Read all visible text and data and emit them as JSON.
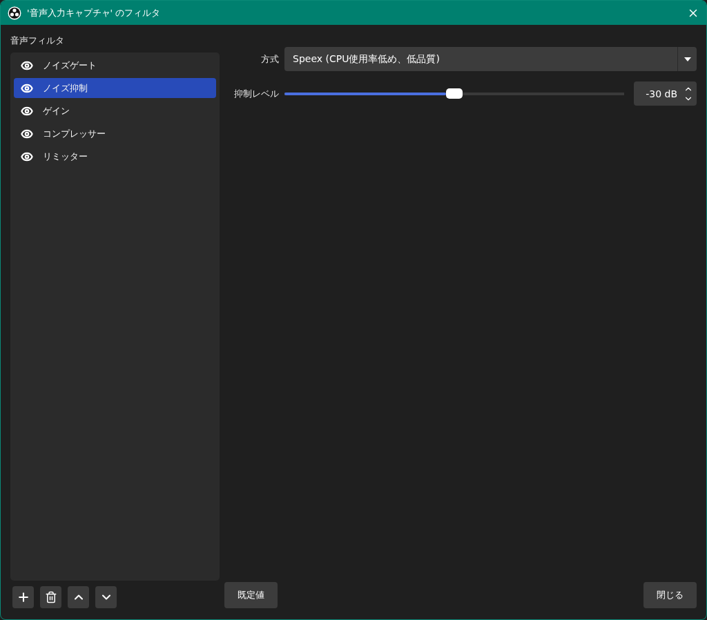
{
  "window": {
    "title": "'音声入力キャプチャ' のフィルタ"
  },
  "sidebar": {
    "heading": "音声フィルタ",
    "items": [
      {
        "label": "ノイズゲート",
        "visible": true,
        "selected": false
      },
      {
        "label": "ノイズ抑制",
        "visible": true,
        "selected": true
      },
      {
        "label": "ゲイン",
        "visible": true,
        "selected": false
      },
      {
        "label": "コンプレッサー",
        "visible": true,
        "selected": false
      },
      {
        "label": "リミッター",
        "visible": true,
        "selected": false
      }
    ]
  },
  "settings": {
    "method": {
      "label": "方式",
      "value": "Speex (CPU使用率低め、低品質)"
    },
    "suppression": {
      "label": "抑制レベル",
      "level": 0.5,
      "reading": "-30 dB"
    }
  },
  "buttons": {
    "defaults": "既定値",
    "close": "閉じる"
  }
}
